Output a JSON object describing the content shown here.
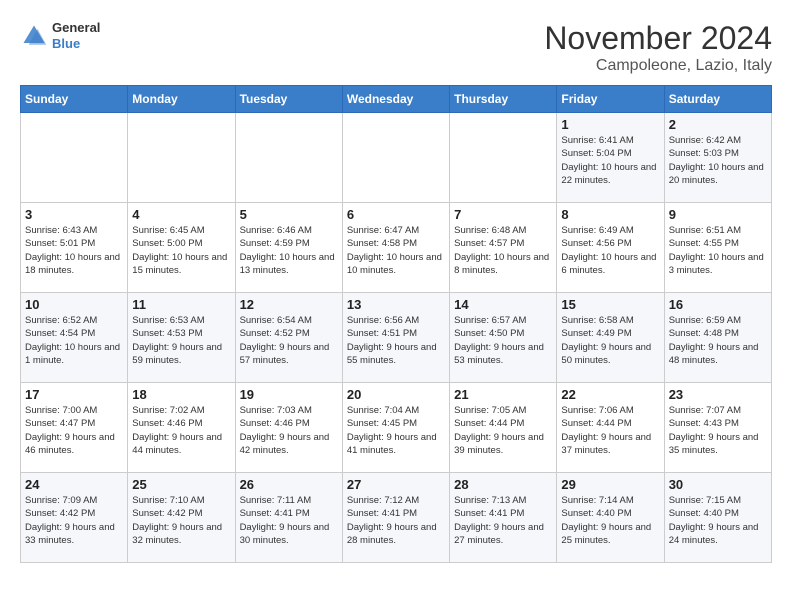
{
  "header": {
    "logo": {
      "general": "General",
      "blue": "Blue"
    },
    "title": "November 2024",
    "location": "Campoleone, Lazio, Italy"
  },
  "weekdays": [
    "Sunday",
    "Monday",
    "Tuesday",
    "Wednesday",
    "Thursday",
    "Friday",
    "Saturday"
  ],
  "weeks": [
    [
      {
        "day": "",
        "info": ""
      },
      {
        "day": "",
        "info": ""
      },
      {
        "day": "",
        "info": ""
      },
      {
        "day": "",
        "info": ""
      },
      {
        "day": "",
        "info": ""
      },
      {
        "day": "1",
        "info": "Sunrise: 6:41 AM\nSunset: 5:04 PM\nDaylight: 10 hours\nand 22 minutes."
      },
      {
        "day": "2",
        "info": "Sunrise: 6:42 AM\nSunset: 5:03 PM\nDaylight: 10 hours\nand 20 minutes."
      }
    ],
    [
      {
        "day": "3",
        "info": "Sunrise: 6:43 AM\nSunset: 5:01 PM\nDaylight: 10 hours\nand 18 minutes."
      },
      {
        "day": "4",
        "info": "Sunrise: 6:45 AM\nSunset: 5:00 PM\nDaylight: 10 hours\nand 15 minutes."
      },
      {
        "day": "5",
        "info": "Sunrise: 6:46 AM\nSunset: 4:59 PM\nDaylight: 10 hours\nand 13 minutes."
      },
      {
        "day": "6",
        "info": "Sunrise: 6:47 AM\nSunset: 4:58 PM\nDaylight: 10 hours\nand 10 minutes."
      },
      {
        "day": "7",
        "info": "Sunrise: 6:48 AM\nSunset: 4:57 PM\nDaylight: 10 hours\nand 8 minutes."
      },
      {
        "day": "8",
        "info": "Sunrise: 6:49 AM\nSunset: 4:56 PM\nDaylight: 10 hours\nand 6 minutes."
      },
      {
        "day": "9",
        "info": "Sunrise: 6:51 AM\nSunset: 4:55 PM\nDaylight: 10 hours\nand 3 minutes."
      }
    ],
    [
      {
        "day": "10",
        "info": "Sunrise: 6:52 AM\nSunset: 4:54 PM\nDaylight: 10 hours\nand 1 minute."
      },
      {
        "day": "11",
        "info": "Sunrise: 6:53 AM\nSunset: 4:53 PM\nDaylight: 9 hours\nand 59 minutes."
      },
      {
        "day": "12",
        "info": "Sunrise: 6:54 AM\nSunset: 4:52 PM\nDaylight: 9 hours\nand 57 minutes."
      },
      {
        "day": "13",
        "info": "Sunrise: 6:56 AM\nSunset: 4:51 PM\nDaylight: 9 hours\nand 55 minutes."
      },
      {
        "day": "14",
        "info": "Sunrise: 6:57 AM\nSunset: 4:50 PM\nDaylight: 9 hours\nand 53 minutes."
      },
      {
        "day": "15",
        "info": "Sunrise: 6:58 AM\nSunset: 4:49 PM\nDaylight: 9 hours\nand 50 minutes."
      },
      {
        "day": "16",
        "info": "Sunrise: 6:59 AM\nSunset: 4:48 PM\nDaylight: 9 hours\nand 48 minutes."
      }
    ],
    [
      {
        "day": "17",
        "info": "Sunrise: 7:00 AM\nSunset: 4:47 PM\nDaylight: 9 hours\nand 46 minutes."
      },
      {
        "day": "18",
        "info": "Sunrise: 7:02 AM\nSunset: 4:46 PM\nDaylight: 9 hours\nand 44 minutes."
      },
      {
        "day": "19",
        "info": "Sunrise: 7:03 AM\nSunset: 4:46 PM\nDaylight: 9 hours\nand 42 minutes."
      },
      {
        "day": "20",
        "info": "Sunrise: 7:04 AM\nSunset: 4:45 PM\nDaylight: 9 hours\nand 41 minutes."
      },
      {
        "day": "21",
        "info": "Sunrise: 7:05 AM\nSunset: 4:44 PM\nDaylight: 9 hours\nand 39 minutes."
      },
      {
        "day": "22",
        "info": "Sunrise: 7:06 AM\nSunset: 4:44 PM\nDaylight: 9 hours\nand 37 minutes."
      },
      {
        "day": "23",
        "info": "Sunrise: 7:07 AM\nSunset: 4:43 PM\nDaylight: 9 hours\nand 35 minutes."
      }
    ],
    [
      {
        "day": "24",
        "info": "Sunrise: 7:09 AM\nSunset: 4:42 PM\nDaylight: 9 hours\nand 33 minutes."
      },
      {
        "day": "25",
        "info": "Sunrise: 7:10 AM\nSunset: 4:42 PM\nDaylight: 9 hours\nand 32 minutes."
      },
      {
        "day": "26",
        "info": "Sunrise: 7:11 AM\nSunset: 4:41 PM\nDaylight: 9 hours\nand 30 minutes."
      },
      {
        "day": "27",
        "info": "Sunrise: 7:12 AM\nSunset: 4:41 PM\nDaylight: 9 hours\nand 28 minutes."
      },
      {
        "day": "28",
        "info": "Sunrise: 7:13 AM\nSunset: 4:41 PM\nDaylight: 9 hours\nand 27 minutes."
      },
      {
        "day": "29",
        "info": "Sunrise: 7:14 AM\nSunset: 4:40 PM\nDaylight: 9 hours\nand 25 minutes."
      },
      {
        "day": "30",
        "info": "Sunrise: 7:15 AM\nSunset: 4:40 PM\nDaylight: 9 hours\nand 24 minutes."
      }
    ]
  ]
}
